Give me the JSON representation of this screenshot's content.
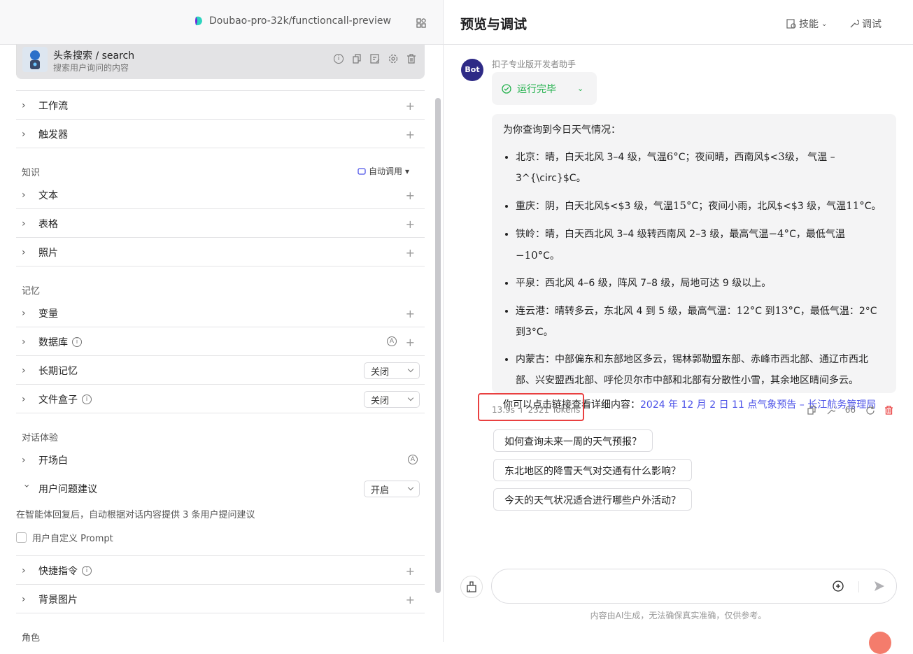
{
  "left": {
    "model": "Doubao-pro-32k/functioncall-preview",
    "plugin": {
      "title": "头条搜索 / search",
      "desc": "搜索用户询问的内容"
    },
    "rows1": [
      {
        "label": "工作流"
      },
      {
        "label": "触发器"
      }
    ],
    "knowledge": {
      "heading": "知识",
      "auto": "自动调用",
      "rows": [
        {
          "label": "文本"
        },
        {
          "label": "表格"
        },
        {
          "label": "照片"
        }
      ]
    },
    "memory": {
      "heading": "记忆",
      "rows": [
        {
          "label": "变量"
        },
        {
          "label": "数据库"
        },
        {
          "label": "长期记忆",
          "value": "关闭"
        },
        {
          "label": "文件盒子",
          "value": "关闭"
        }
      ]
    },
    "dialog": {
      "heading": "对话体验",
      "opening": "开场白",
      "suggest": "用户问题建议",
      "suggest_value": "开启",
      "suggest_desc": "在智能体回复后，自动根据对话内容提供 3 条用户提问建议",
      "custom_prompt": "用户自定义 Prompt",
      "shortcut": "快捷指令",
      "background": "背景图片"
    },
    "role_heading": "角色"
  },
  "right": {
    "title": "预览与调试",
    "skills": "技能",
    "debug": "调试",
    "bot_avatar": "Bot",
    "bot_name": "扣子专业版开发者助手",
    "run_status": "运行完毕",
    "intro": "为你查询到今日天气情况：",
    "items": [
      [
        "北京：晴，白天北风 3–4 级，气温",
        "6°",
        "C；夜间晴，西南风$<",
        "3",
        "级， 气温 –3^{\\circ}$C。"
      ],
      [
        "重庆：阴，白天北风$<$3 级，气温",
        "15°",
        "C；夜间小雨，北风$<$3 级，气温",
        "11°",
        "C。"
      ],
      [
        "铁岭：晴，白天西北风 3–4 级转西南风 2–3 级，最高气温",
        "−4°",
        "C，最低气温",
        "−10°",
        "C。"
      ],
      [
        "平泉：西北风 4–6 级，阵风 7–8 级，局地可达 9 级以上。",
        "",
        "",
        "",
        ""
      ],
      [
        "连云港：晴转多云，东北风 4 到 5 级，最高气温：",
        "12°",
        "C 到",
        "13°",
        "C，最低气温：2°C 到3°C。"
      ],
      [
        "内蒙古：中部偏东和东部地区多云，锡林郭勒盟东部、赤峰市西北部、通辽市西北部、兴安盟西北部、呼伦贝尔市中部和北部有分散性小雪，其余地区晴间多云。",
        "",
        "",
        "",
        ""
      ]
    ],
    "link_prefix": "你可以点击链接查看详细内容：",
    "link": "2024 年 12 月 2 日 11 点气象预告 – 长江航务管理局",
    "time": "13.9s",
    "tokens": "2321 Tokens",
    "suggestions": [
      "如何查询未来一周的天气预报？",
      "东北地区的降雪天气对交通有什么影响？",
      "今天的天气状况适合进行哪些户外活动？"
    ],
    "input_placeholder": "",
    "footer": "内容由AI生成，无法确保真实准确，仅供参考。",
    "colors": {
      "accent": "#4d53e8",
      "success": "#20b04a",
      "highlight": "#e94040"
    }
  }
}
